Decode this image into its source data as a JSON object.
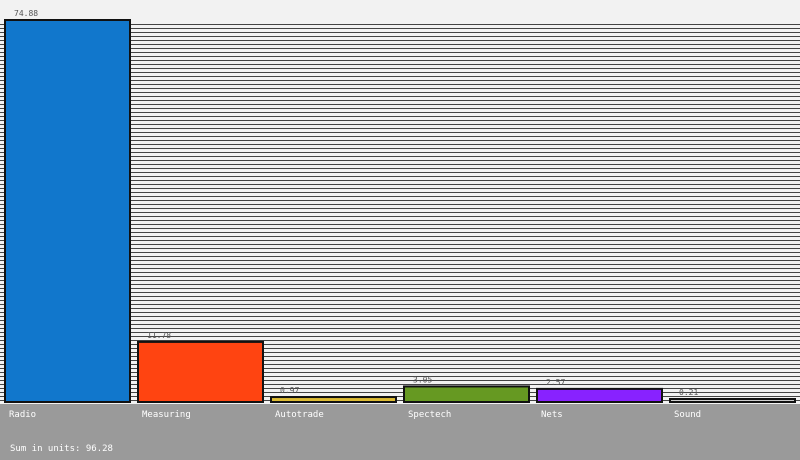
{
  "chart_data": {
    "type": "bar",
    "categories": [
      "Radio",
      "Measuring",
      "Autotrade",
      "Spectech",
      "Nets",
      "Sound"
    ],
    "values": [
      74.88,
      11.78,
      0.97,
      3.05,
      2.57,
      0.21
    ],
    "value_labels": [
      "74.88",
      "11.78",
      "0.97",
      "3.05",
      "2.57",
      "0.21"
    ],
    "colors": [
      "#1177cc",
      "#ff4411",
      "#ddbb33",
      "#669922",
      "#8822ff",
      "#cccccc"
    ],
    "title": "",
    "xlabel": "",
    "ylabel": "",
    "ylim": [
      0,
      74.88
    ],
    "grid": true,
    "legend": "none"
  },
  "footer": {
    "prefix": "Sum in units: ",
    "total": "96.28"
  }
}
